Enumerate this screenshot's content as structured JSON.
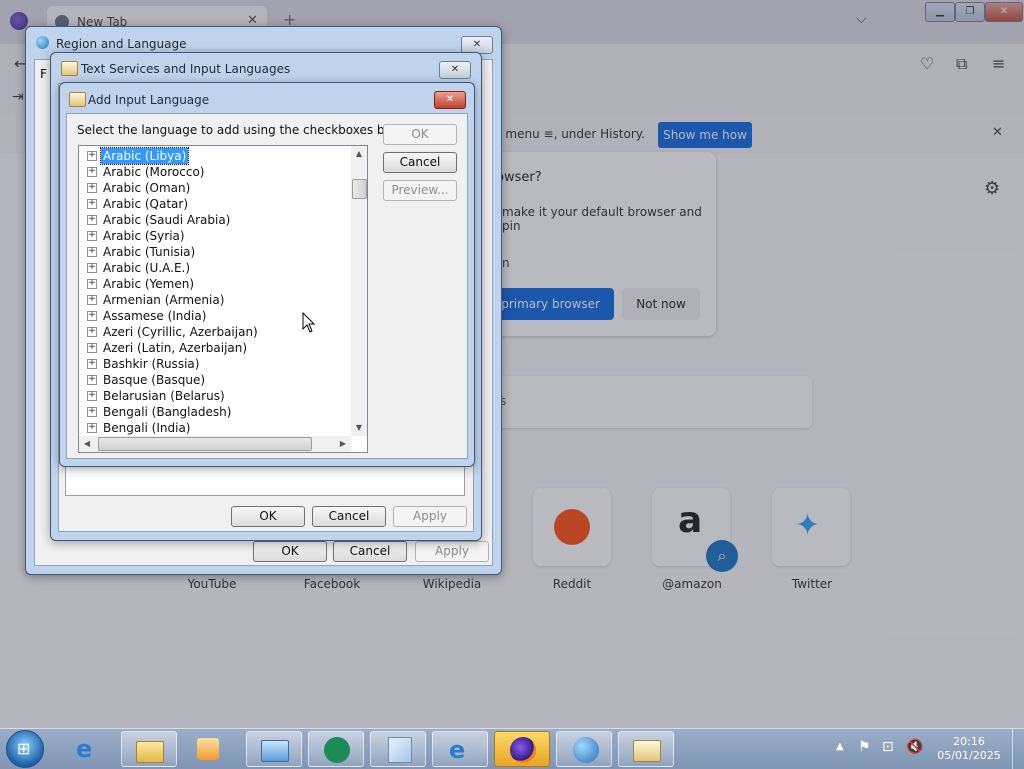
{
  "browser": {
    "tab_title": "New Tab",
    "notification": {
      "text": "n menu ≡, under History.",
      "button": "Show me how"
    },
    "default_card": {
      "question": "owser?",
      "description": "make it your default browser and pin",
      "option": "n",
      "primary_button": "e primary browser",
      "secondary_button": "Not now"
    },
    "search_placeholder": "s",
    "shortcuts": [
      "YouTube",
      "Facebook",
      "Wikipedia",
      "Reddit",
      "@amazon",
      "Twitter"
    ]
  },
  "region_dialog": {
    "title": "Region and Language",
    "tab_fragment": "F",
    "ok": "OK",
    "cancel": "Cancel",
    "apply": "Apply"
  },
  "text_services_dialog": {
    "title": "Text Services and Input Languages",
    "ok": "OK",
    "cancel": "Cancel",
    "apply": "Apply"
  },
  "add_input_dialog": {
    "title": "Add Input Language",
    "instruction": "Select the language to add using the checkboxes below.",
    "ok": "OK",
    "cancel": "Cancel",
    "preview": "Preview...",
    "languages": [
      "Arabic (Libya)",
      "Arabic (Morocco)",
      "Arabic (Oman)",
      "Arabic (Qatar)",
      "Arabic (Saudi Arabia)",
      "Arabic (Syria)",
      "Arabic (Tunisia)",
      "Arabic (U.A.E.)",
      "Arabic (Yemen)",
      "Armenian (Armenia)",
      "Assamese (India)",
      "Azeri (Cyrillic, Azerbaijan)",
      "Azeri (Latin, Azerbaijan)",
      "Bashkir (Russia)",
      "Basque (Basque)",
      "Belarusian (Belarus)",
      "Bengali (Bangladesh)",
      "Bengali (India)"
    ],
    "selected_language": "Arabic (Libya)"
  },
  "taskbar": {
    "time": "20:16",
    "date": "05/01/2025"
  }
}
